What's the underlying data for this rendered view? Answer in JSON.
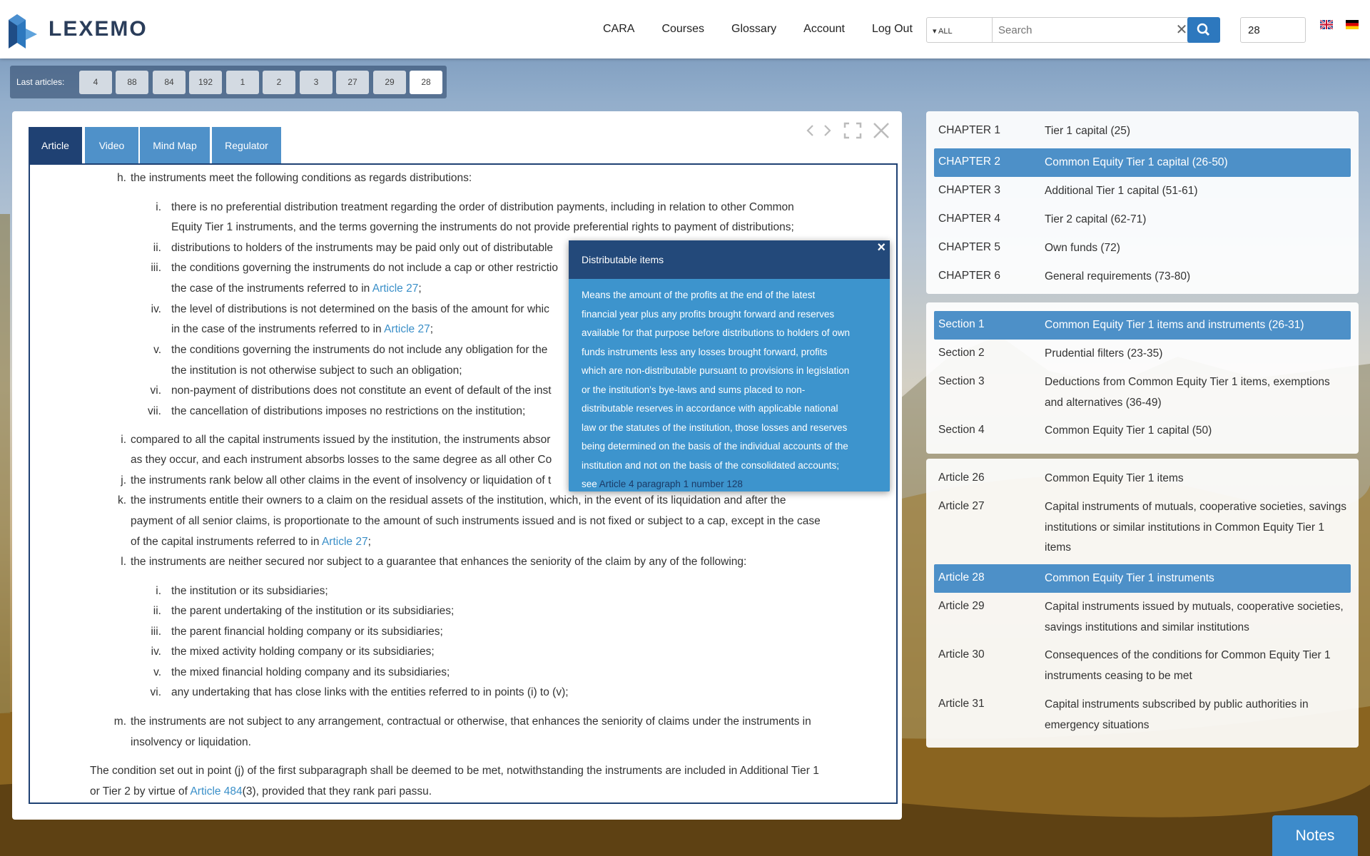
{
  "brand": {
    "name": "LEXEMO"
  },
  "nav": {
    "items": [
      "CARA",
      "Courses",
      "Glossary",
      "Account",
      "Log Out"
    ]
  },
  "search": {
    "scope": "ALL",
    "placeholder": "Search",
    "value": ""
  },
  "article_number": {
    "value": "28"
  },
  "last_articles": {
    "label": "Last articles:",
    "items": [
      "4",
      "88",
      "84",
      "192",
      "1",
      "2",
      "3",
      "27",
      "29",
      "28"
    ]
  },
  "tabs": [
    "Article",
    "Video",
    "Mind Map",
    "Regulator"
  ],
  "article": {
    "h": {
      "marker": "h.",
      "text": "the instruments meet the following conditions as regards distributions:"
    },
    "h_items": [
      {
        "marker": "i.",
        "l1": "there is no preferential distribution treatment regarding the order of distribution payments, including in relation to other Common",
        "l2": "Equity Tier 1 instruments, and the terms governing the instruments do not provide preferential rights to payment of distributions;"
      },
      {
        "marker": "ii.",
        "l1": "distributions to holders of the instruments may be paid only out of distributable",
        "l2": ""
      },
      {
        "marker": "iii.",
        "l1": "the conditions governing the instruments do not include a cap or other restrictio",
        "l2": "the case of the instruments referred to in",
        "link": "Article 27",
        "tail": ";"
      },
      {
        "marker": "iv.",
        "l1": "the level of distributions is not determined on the basis of the amount for whic",
        "l2": "in the case of the instruments referred to in",
        "link": "Article 27",
        "tail": ";"
      },
      {
        "marker": "v.",
        "l1": "the conditions governing the instruments do not include any obligation for the",
        "l2": "the institution is not otherwise subject to such an obligation;"
      },
      {
        "marker": "vi.",
        "l1": "non-payment of distributions does not constitute an event of default of the inst",
        "l2": ""
      },
      {
        "marker": "vii.",
        "l1": "the cancellation of distributions imposes no restrictions on the institution;",
        "l2": ""
      }
    ],
    "i": {
      "marker": "i.",
      "l1": "compared to all the capital instruments issued by the institution, the instruments absor",
      "l2": "as they occur, and each instrument absorbs losses to the same degree as all other Co"
    },
    "j": {
      "marker": "j.",
      "l1": "the instruments rank below all other claims in the event of insolvency or liquidation of t"
    },
    "k": {
      "marker": "k.",
      "l1": "the instruments entitle their owners to a claim on the residual assets of the institution, which, in the event of its liquidation and after the",
      "l2": "payment of all senior claims, is proportionate to the amount of such instruments issued and is not fixed or subject to a cap, except in the case",
      "l3": "of the capital instruments referred to in",
      "link": "Article 27",
      "tail": ";"
    },
    "l": {
      "marker": "l.",
      "l1": "the instruments are neither secured nor subject to a guarantee that enhances the seniority of the claim by any of the following:"
    },
    "l_items": [
      {
        "marker": "i.",
        "text": "the institution or its subsidiaries;"
      },
      {
        "marker": "ii.",
        "text": "the parent undertaking of the institution or its subsidiaries;"
      },
      {
        "marker": "iii.",
        "text": "the parent financial holding company or its subsidiaries;"
      },
      {
        "marker": "iv.",
        "text": "the mixed activity holding company or its subsidiaries;"
      },
      {
        "marker": "v.",
        "text": "the mixed financial holding company and its subsidiaries;"
      },
      {
        "marker": "vi.",
        "text": "any undertaking that has close links with the entities referred to in points (i) to (v);"
      }
    ],
    "m": {
      "marker": "m.",
      "l1": "the instruments are not subject to any arrangement, contractual or otherwise, that enhances the seniority of claims under the instruments in",
      "l2": "insolvency or liquidation."
    },
    "final": {
      "l1": "The condition set out in point (j) of the first subparagraph shall be deemed to be met, notwithstanding the instruments are included in Additional Tier 1",
      "l2_pre": "or Tier 2 by virtue of",
      "link": "Article 484",
      "l2_post": "(3), provided that they rank pari passu."
    }
  },
  "popup": {
    "title": "Distributable items",
    "lines": [
      "Means the amount of the profits at the end of the latest",
      "financial year plus any profits brought forward and reserves",
      "available for that purpose before distributions to holders of own",
      "funds instruments less any losses brought forward, profits",
      "which are non-distributable pursuant to provisions in legislation",
      "or the institution's bye-laws and sums placed to non-",
      "distributable reserves in accordance with applicable national",
      "law or the statutes of the institution, those losses and reserves",
      "being determined on the basis of the individual accounts of the",
      "institution and not on the basis of the consolidated accounts;"
    ],
    "see": "see",
    "link": "Article 4 paragraph 1 number 128"
  },
  "chapters": [
    {
      "k": "CHAPTER 1",
      "v": "Tier 1 capital (25)"
    },
    {
      "k": "CHAPTER 2",
      "v": "Common Equity Tier 1 capital (26-50)",
      "active": true
    },
    {
      "k": "CHAPTER 3",
      "v": "Additional Tier 1 capital (51-61)"
    },
    {
      "k": "CHAPTER 4",
      "v": "Tier 2 capital (62-71)"
    },
    {
      "k": "CHAPTER 5",
      "v": "Own funds (72)"
    },
    {
      "k": "CHAPTER 6",
      "v": "General requirements (73-80)"
    }
  ],
  "sections": [
    {
      "k": "Section 1",
      "v": "Common Equity Tier 1 items and instruments (26-31)",
      "active": true
    },
    {
      "k": "Section 2",
      "v": "Prudential filters (23-35)"
    },
    {
      "k": "Section 3",
      "v": "Deductions from Common Equity Tier 1 items, exemptions and alternatives (36-49)"
    },
    {
      "k": "Section 4",
      "v": "Common Equity Tier 1 capital (50)"
    }
  ],
  "articles": [
    {
      "k": "Article 26",
      "v": "Common Equity Tier 1 items"
    },
    {
      "k": "Article 27",
      "v": "Capital instruments of mutuals, cooperative societies, savings institutions or similar institutions in Common Equity Tier 1 items"
    },
    {
      "k": "Article 28",
      "v": "Common Equity Tier 1 instruments",
      "active": true
    },
    {
      "k": "Article 29",
      "v": "Capital instruments issued by mutuals, cooperative societies, savings institutions and similar institutions"
    },
    {
      "k": "Article 30",
      "v": "Consequences of the conditions for Common Equity Tier 1 instruments ceasing to be met"
    },
    {
      "k": "Article 31",
      "v": "Capital instruments subscribed by public authorities in emergency situations"
    }
  ],
  "notes": {
    "label": "Notes"
  },
  "colors": {
    "navy": "#1f4173",
    "accent": "#4d90c8",
    "popup": "#3d94cd",
    "search": "#2d78be"
  }
}
